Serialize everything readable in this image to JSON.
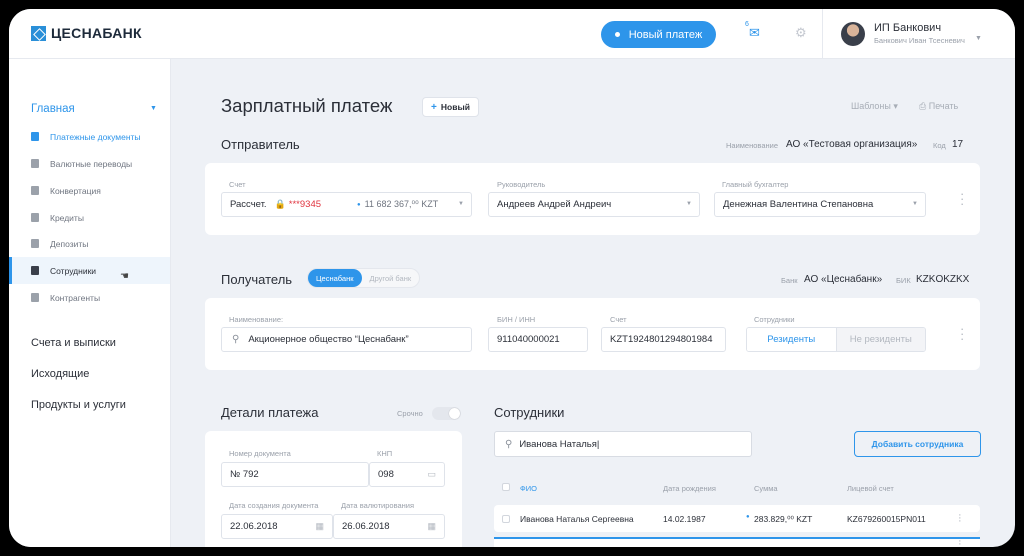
{
  "brand": {
    "name": "ЦЕСНАБАНК"
  },
  "header": {
    "new_payment_label": "Новый платеж",
    "mail_count": "6",
    "user_name": "ИП Банкович",
    "user_subtitle": "Банкович Иван Тсесневич"
  },
  "sidebar": {
    "main_label": "Главная",
    "items": [
      {
        "label": "Платежные документы",
        "icon": "document-icon"
      },
      {
        "label": "Валютные переводы",
        "icon": "wallet-icon"
      },
      {
        "label": "Конвертация",
        "icon": "calculator-icon"
      },
      {
        "label": "Кредиты",
        "icon": "card-icon"
      },
      {
        "label": "Депозиты",
        "icon": "briefcase-icon"
      },
      {
        "label": "Сотрудники",
        "icon": "users-icon"
      },
      {
        "label": "Контрагенты",
        "icon": "book-icon"
      }
    ],
    "sections": [
      "Счета и выписки",
      "Исходящие",
      "Продукты и услуги"
    ]
  },
  "page": {
    "title": "Зарплатный платеж",
    "new_button": "Новый",
    "templates_label": "Шаблоны",
    "print_label": "Печать"
  },
  "sender": {
    "title": "Отправитель",
    "name_label": "Наименование",
    "name_value": "АО «Тестовая организация»",
    "code_label": "Код",
    "code_value": "17",
    "account_label": "Счет",
    "account_type": "Рассчет.",
    "account_number": "***9345",
    "account_balance": "11 682 367,⁰⁰ KZT",
    "director_label": "Руководитель",
    "director_value": "Андреев Андрей Андреич",
    "accountant_label": "Главный бухгалтер",
    "accountant_value": "Денежная Валентина Степановна"
  },
  "recipient": {
    "title": "Получатель",
    "bank_toggle": [
      "Цеснабанк",
      "Другой банк"
    ],
    "bank_label": "Банк",
    "bank_value": "АО «Цеснабанк»",
    "bik_label": "БИК",
    "bik_value": "KZKOKZKX",
    "name_label": "Наименование:",
    "name_value": "Акционерное общество “Цеснабанк”",
    "bin_label": "БИН / ИНН",
    "bin_value": "911040000021",
    "account_label": "Счет",
    "account_value": "KZT1924801294801984",
    "employees_label": "Сотрудники",
    "residents_label": "Резиденты",
    "nonresidents_label": "Не резиденты"
  },
  "details": {
    "title": "Детали платежа",
    "urgent_label": "Срочно",
    "urgent_on": false,
    "doc_number_label": "Номер документа",
    "doc_number_value": "№ 792",
    "knp_label": "КНП",
    "knp_value": "098",
    "created_label": "Дата создания документа",
    "created_value": "22.06.2018",
    "value_date_label": "Дата валютирования",
    "value_date_value": "26.06.2018"
  },
  "employees": {
    "title": "Сотрудники",
    "search_value": "Иванова Наталья|",
    "add_button": "Добавить сотрудника",
    "columns": [
      "ФИО",
      "Дата рождения",
      "Сумма",
      "Лицевой счет"
    ],
    "rows": [
      {
        "name": "Иванова Наталья Сергеевна",
        "birth": "14.02.1987",
        "sum": "283.829,⁰⁰ KZT",
        "account": "KZ679260015PN011"
      }
    ]
  }
}
